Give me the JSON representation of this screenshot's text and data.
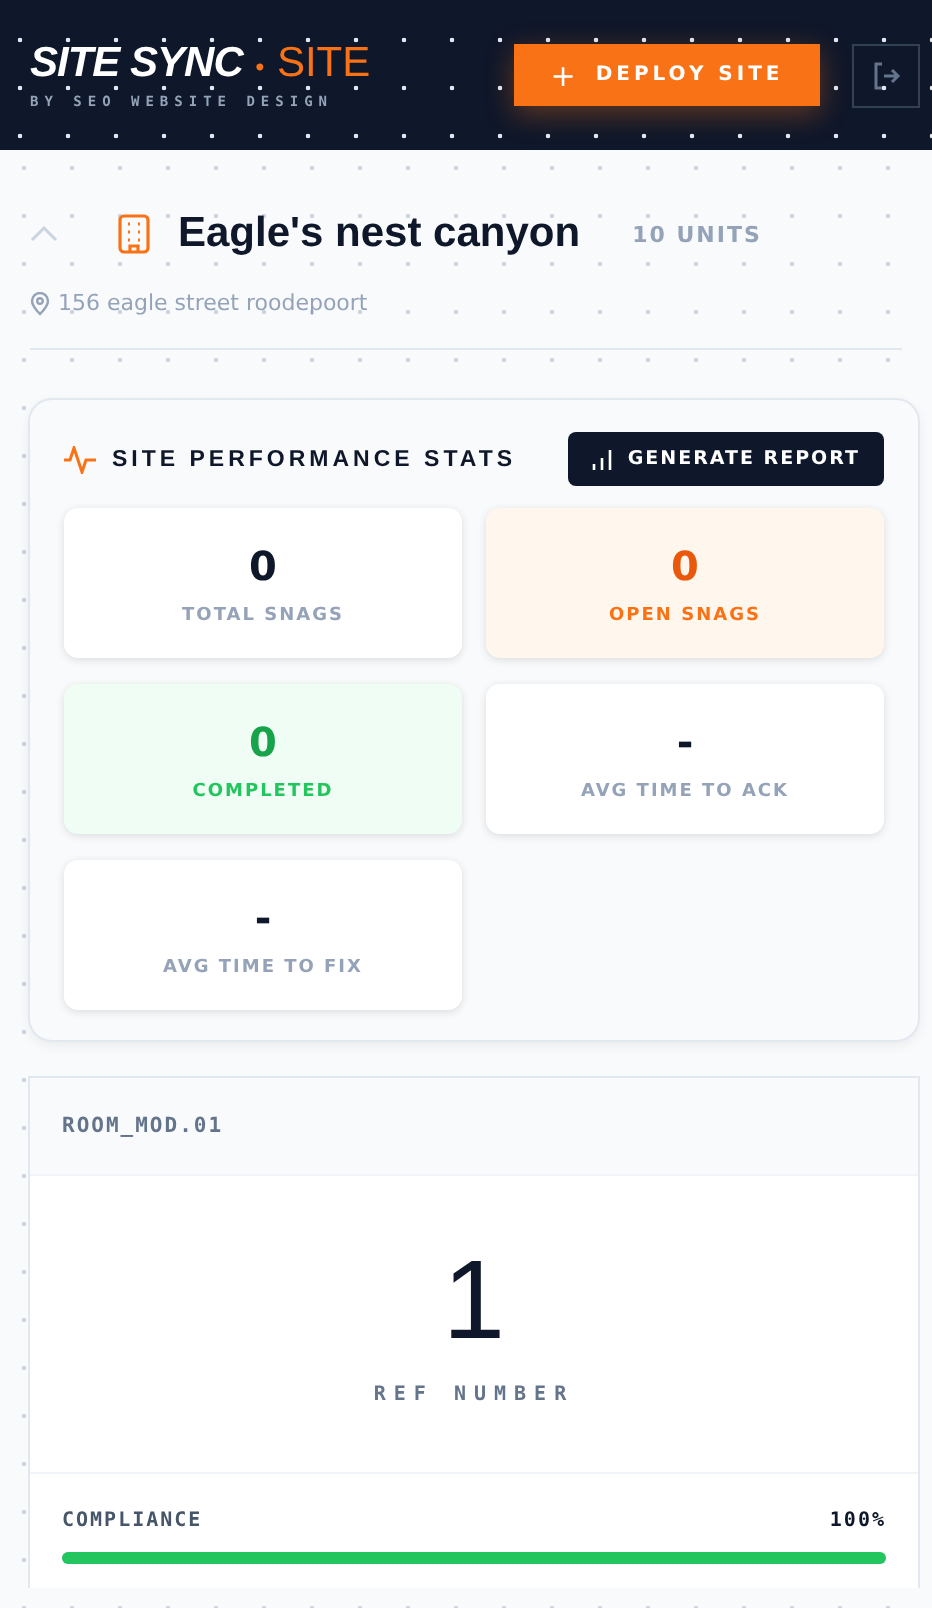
{
  "header": {
    "brand": "SITE SYNC",
    "separator": "•",
    "mode": "SITE",
    "tagline": "BY SEO WEBSITE DESIGN",
    "deploy_button": {
      "icon": "+",
      "label": "DEPLOY SITE"
    }
  },
  "site": {
    "expanded": true,
    "name": "Eagle's nest canyon",
    "units": "10 UNITS",
    "address": "156 eagle street roodepoort"
  },
  "stats": {
    "title": "SITE PERFORMANCE STATS",
    "report_button": "GENERATE REPORT",
    "items": [
      {
        "value": "0",
        "label": "TOTAL SNAGS",
        "kind": "plain"
      },
      {
        "value": "0",
        "label": "OPEN SNAGS",
        "kind": "warning"
      },
      {
        "value": "0",
        "label": "COMPLETED",
        "kind": "success"
      },
      {
        "value": "-",
        "label": "AVG TIME TO ACK",
        "kind": "plain"
      },
      {
        "value": "-",
        "label": "AVG TIME TO FIX",
        "kind": "plain"
      }
    ]
  },
  "unit": {
    "code": "ROOM_MOD.01",
    "ref": "1",
    "ref_label": "REF NUMBER",
    "compliance_label": "COMPLIANCE",
    "compliance_reading": "100%",
    "level": 1
  }
}
